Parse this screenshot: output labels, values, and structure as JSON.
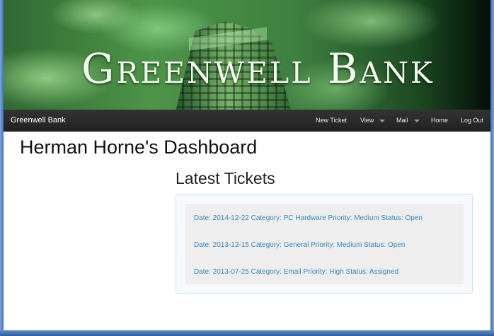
{
  "banner": {
    "title": "Greenwell Bank"
  },
  "navbar": {
    "brand": "Greenwell Bank",
    "items": [
      {
        "label": "New Ticket",
        "dropdown": false
      },
      {
        "label": "View",
        "dropdown": true
      },
      {
        "label": "Mail",
        "dropdown": true
      },
      {
        "label": "Home",
        "dropdown": false
      },
      {
        "label": "Log Out",
        "dropdown": false
      }
    ]
  },
  "dashboard": {
    "title": "Herman Horne's Dashboard",
    "section_title": "Latest Tickets"
  },
  "tickets": [
    "Date: 2014-12-22 Category: PC Hardware Priority: Medium Status: Open",
    "Date: 2013-12-15 Category: General Priority: Medium Status: Open",
    "Date: 2013-07-25 Category: Email Priority: High Status: Assigned"
  ],
  "colors": {
    "navbar": "#222222",
    "link": "#3a87c0",
    "panel_border": "#cfe3f0",
    "list_background": "#eeeeee"
  }
}
